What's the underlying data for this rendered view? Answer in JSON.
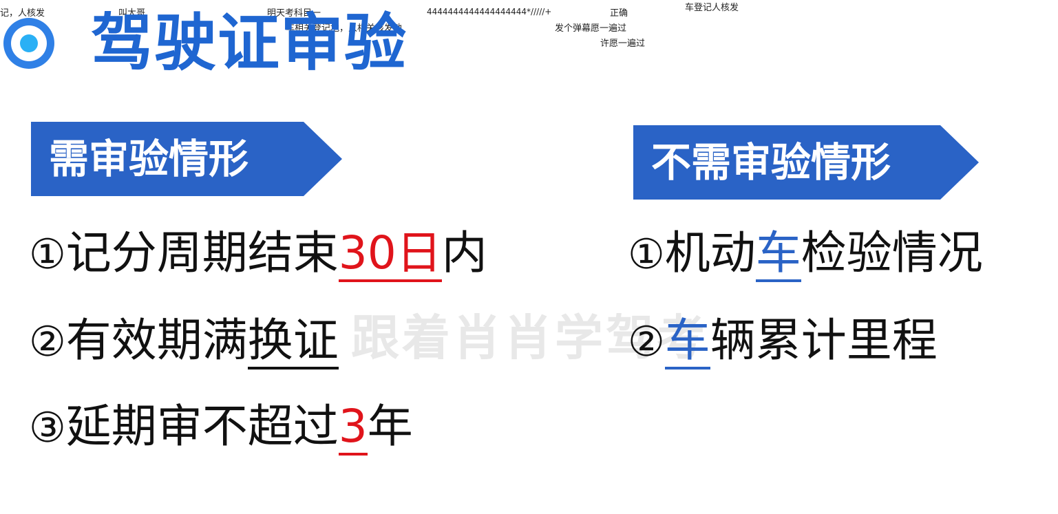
{
  "danmaku": [
    {
      "text": "记，人核发"
    },
    {
      "text": "叫大哥"
    },
    {
      "text": "明天考科目一"
    },
    {
      "text": "车相关登记地，人相关核发地"
    },
    {
      "text": "4444444444444444444*/////+"
    },
    {
      "text": "正确"
    },
    {
      "text": "发个弹幕愿一遍过"
    },
    {
      "text": "许愿一遍过"
    },
    {
      "text": "车登记人核发"
    }
  ],
  "title": "驾驶证审验",
  "left_banner": "需审验情形",
  "right_banner": "不需审验情形",
  "left_items": [
    {
      "num": "①",
      "pre": "记分周期结束",
      "highlight": "30日",
      "post": "内"
    },
    {
      "num": "②",
      "pre": "有效期满",
      "highlight": "换证",
      "post": ""
    },
    {
      "num": "③",
      "pre": "延期审不超过",
      "highlight": "3",
      "post": "年"
    }
  ],
  "right_items": [
    {
      "num": "①",
      "pre": "机动",
      "highlight": "车",
      "post": "检验情况"
    },
    {
      "num": "②",
      "pre": "",
      "highlight": "车",
      "post": "辆累计里程"
    }
  ],
  "watermark": "跟着肖肖学驾考",
  "colors": {
    "title_blue": "#1f66d1",
    "banner_blue": "#2a63c6",
    "accent_red": "#e0141b"
  }
}
